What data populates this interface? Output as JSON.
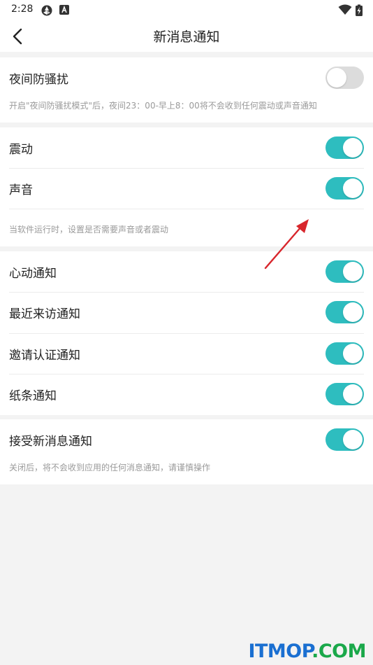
{
  "status_bar": {
    "time": "2:28"
  },
  "header": {
    "title": "新消息通知"
  },
  "sections": {
    "night": {
      "label": "夜间防骚扰",
      "on": false,
      "note": "开启\"夜间防骚扰模式\"后，夜间23：00-早上8：00将不会收到任何震动或声音通知"
    },
    "vibrate": {
      "label": "震动",
      "on": true
    },
    "sound": {
      "label": "声音",
      "on": true
    },
    "sound_note": "当软件运行时，设置是否需要声音或者震动",
    "heart": {
      "label": "心动通知",
      "on": true
    },
    "visitor": {
      "label": "最近来访通知",
      "on": true
    },
    "invite": {
      "label": "邀请认证通知",
      "on": true
    },
    "paper": {
      "label": "纸条通知",
      "on": true
    },
    "receive": {
      "label": "接受新消息通知",
      "on": true,
      "note": "关闭后，将不会收到应用的任何消息通知，请谨慎操作"
    }
  },
  "watermark": {
    "brand": "ITMOP",
    "suffix": ".COM"
  },
  "colors": {
    "accent": "#2ebdbf",
    "toggle_off": "#dcdcdc",
    "watermark_blue": "#1a6fd1",
    "watermark_green": "#1aa84a",
    "arrow": "#d8262c"
  }
}
